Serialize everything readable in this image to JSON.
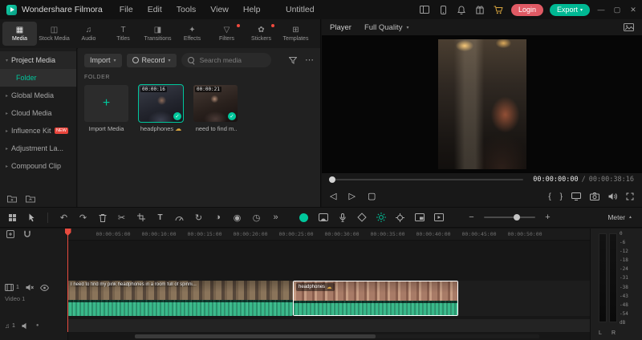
{
  "colors": {
    "accent": "#00c79c",
    "login_button": "#e05a64",
    "export_button": "#00b893",
    "badge": "#f04a3e",
    "waveform": "#38b98a",
    "playhead": "#e84b3f",
    "selection_border": "#ffffff"
  },
  "icons": {
    "chevron_down": "▾",
    "chevron_right": "▸",
    "more": "⋯",
    "undo": "↶",
    "redo": "↷",
    "scissors": "✂",
    "text_tool": "T",
    "rotate": "↻",
    "record_screen": "◉",
    "color_wheel": "◑",
    "clock": "◷",
    "more_tools": "»",
    "minus": "−",
    "plus": "+",
    "play": "▷",
    "stop": "▢",
    "prev_frame": "◁",
    "mark_in": "{",
    "mark_out": "}",
    "meter_collapse": "▲",
    "check": "✓",
    "cloud": "☁",
    "import_plus": "+",
    "note": "♫",
    "dot": "●"
  },
  "titlebar": {
    "app_title": "Wondershare Filmora",
    "menus": [
      "File",
      "Edit",
      "Tools",
      "View",
      "Help"
    ],
    "project_name": "Untitled",
    "login": "Login",
    "export": "Export"
  },
  "tabs": [
    {
      "label": "Media",
      "icon": "▦"
    },
    {
      "label": "Stock Media",
      "icon": "◫"
    },
    {
      "label": "Audio",
      "icon": "♫"
    },
    {
      "label": "Titles",
      "icon": "T"
    },
    {
      "label": "Transitions",
      "icon": "◨"
    },
    {
      "label": "Effects",
      "icon": "✦"
    },
    {
      "label": "Filters",
      "icon": "▽"
    },
    {
      "label": "Stickers",
      "icon": "✿"
    },
    {
      "label": "Templates",
      "icon": "⊞"
    }
  ],
  "sidebar": {
    "items": [
      {
        "label": "Project Media"
      },
      {
        "label": "Folder"
      },
      {
        "label": "Global Media"
      },
      {
        "label": "Cloud Media"
      },
      {
        "label": "Influence Kit",
        "badge": "NEW"
      },
      {
        "label": "Adjustment La..."
      },
      {
        "label": "Compound Clip"
      }
    ]
  },
  "media": {
    "import_button": "Import",
    "record_button": "Record",
    "search_placeholder": "Search media",
    "section": "FOLDER",
    "items": [
      {
        "label": "Import Media"
      },
      {
        "label": "headphones",
        "duration": "00:00:16"
      },
      {
        "label": "I need to find m...",
        "duration": "00:00:21"
      }
    ]
  },
  "player": {
    "label": "Player",
    "quality": "Full Quality",
    "current_time": "00:00:00:00",
    "time_separator": "/",
    "duration": "00:00:38:16"
  },
  "toolbar": {
    "meter_label": "Meter"
  },
  "timeline": {
    "ruler": [
      "00:00:05:00",
      "00:00:10:00",
      "00:00:15:00",
      "00:00:20:00",
      "00:00:25:00",
      "00:00:30:00",
      "00:00:35:00",
      "00:00:40:00",
      "00:00:45:00",
      "00:00:50:00"
    ],
    "video_track": "Video 1",
    "video_num": "1",
    "audio_num": "1",
    "clip1_label": "I need to find my pink headphones in a room full of spinni...",
    "clip2_label": "headphones"
  },
  "meter": {
    "scale": [
      "0",
      "-6",
      "-12",
      "-18",
      "-24",
      "-31",
      "-38",
      "-43",
      "-48",
      "-54",
      "dB"
    ],
    "left": "L",
    "right": "R"
  }
}
